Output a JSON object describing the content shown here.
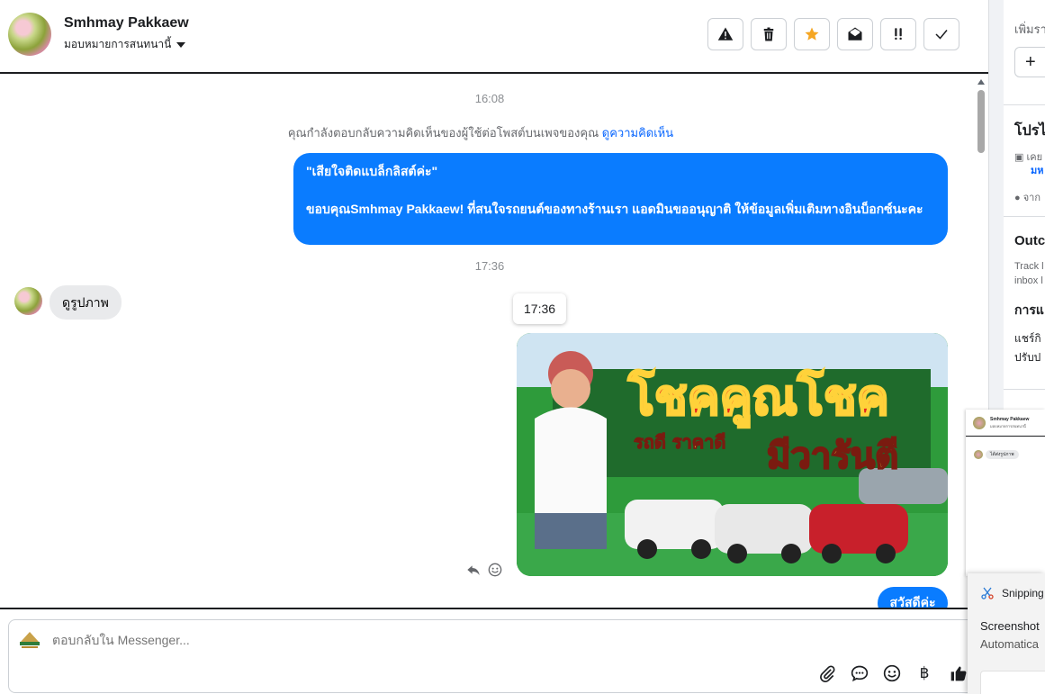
{
  "header": {
    "contact_name": "Smhmay Pakkaew",
    "assign_label": "มอบหมายการสนทนานี้"
  },
  "toolbar": {
    "buttons": [
      "spam",
      "delete",
      "star",
      "mark-unread",
      "follow-up",
      "done"
    ],
    "star_color": "#f5a623"
  },
  "chat": {
    "timestamp_1": "16:08",
    "context_text": "คุณกำลังตอบกลับความคิดเห็นของผู้ใช้ต่อโพสต์บนเพจของคุณ",
    "context_link": "ดูความคิดเห็น",
    "outgoing_quote": "\"เสียใจติดแบล็กลิสต์ค่ะ\"",
    "outgoing_message": "ขอบคุณSmhmay Pakkaew! ที่สนใจรถยนต์ของทางร้านเรา แอดมินขออนุญาติ ให้ข้อมูลเพิ่มเติมทางอินบ็อกซ์นะคะ",
    "timestamp_2": "17:36",
    "incoming_message": "ดูรูปภาพ",
    "tooltip_time": "17:36",
    "image_headline": "โชคคูณโชค",
    "image_sub_1": "รถดี ราคาดี",
    "image_sub_2": "มีวารันตี",
    "partial_message": "สวัสดีค่ะ",
    "bubble_color": "#0a7cff"
  },
  "composer": {
    "placeholder": "ตอบกลับใน Messenger..."
  },
  "right_panel": {
    "top_text": "เพิ่มรา",
    "plus": "+",
    "section_profile": "โปรไ",
    "line_1": "เคย",
    "line_1b": "มห",
    "line_2": "จาก",
    "section_outcome": "Outc",
    "track_1": "Track l",
    "track_2": "inbox l",
    "section_action": "การแ",
    "share_1": "แชร์กิ",
    "share_2": "ปรับป"
  },
  "mini_window": {
    "name": "Smhmay Pakkaew",
    "sub": "มอบหมายการสนทนานี้",
    "bubble": "ได้ส่งรูปภาพ"
  },
  "snipping": {
    "title": "Snipping",
    "heading": "Screenshot",
    "sub": "Automatica"
  }
}
